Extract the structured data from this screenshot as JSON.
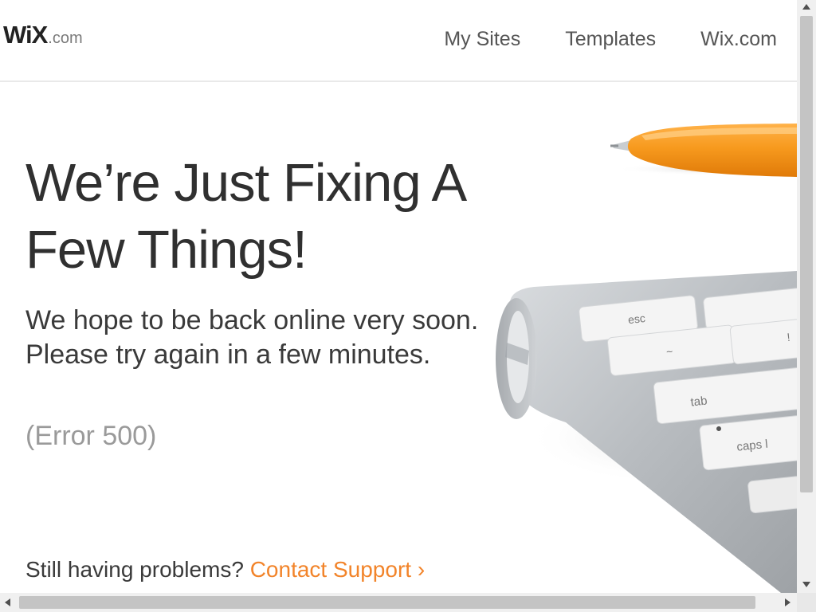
{
  "header": {
    "logo_text": "WiX",
    "logo_suffix": ".com",
    "nav": [
      {
        "label": "My Sites"
      },
      {
        "label": "Templates"
      },
      {
        "label": "Wix.com"
      }
    ]
  },
  "main": {
    "headline": "We’re Just Fixing A Few Things!",
    "subtext_line1": "We hope to be back online very soon.",
    "subtext_line2": "Please try again in a few minutes.",
    "error_code": "(Error 500)",
    "support_prompt": "Still having problems?",
    "support_link": "Contact Support",
    "support_chevron": "›",
    "keyboard_keys": [
      "esc",
      "tab",
      "caps l",
      "~",
      "!"
    ]
  },
  "colors": {
    "accent": "#f2842a",
    "text_dark": "#303030",
    "text_muted": "#9a9a9a",
    "header_border": "#e9e9e9"
  },
  "icons": [
    "scroll-up-arrow-icon",
    "scroll-down-arrow-icon",
    "scroll-left-arrow-icon",
    "scroll-right-arrow-icon",
    "chevron-right-icon"
  ]
}
